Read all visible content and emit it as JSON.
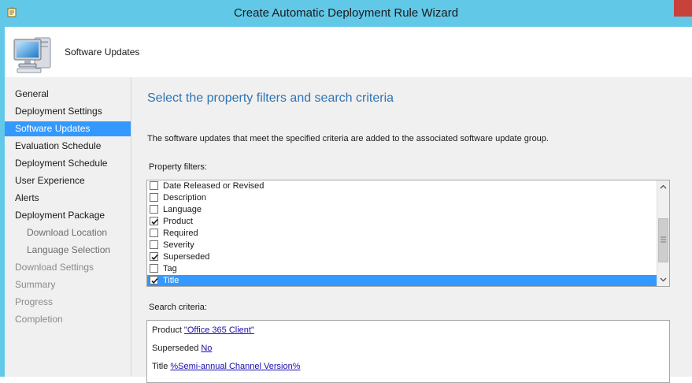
{
  "window": {
    "title": "Create Automatic Deployment Rule Wizard"
  },
  "header": {
    "title": "Software Updates"
  },
  "nav": {
    "items": [
      {
        "label": "General",
        "state": "normal"
      },
      {
        "label": "Deployment Settings",
        "state": "normal"
      },
      {
        "label": "Software Updates",
        "state": "active"
      },
      {
        "label": "Evaluation Schedule",
        "state": "normal"
      },
      {
        "label": "Deployment Schedule",
        "state": "normal"
      },
      {
        "label": "User Experience",
        "state": "normal"
      },
      {
        "label": "Alerts",
        "state": "normal"
      },
      {
        "label": "Deployment Package",
        "state": "normal"
      },
      {
        "label": "Download Location",
        "state": "sub"
      },
      {
        "label": "Language Selection",
        "state": "sub"
      },
      {
        "label": "Download Settings",
        "state": "dim"
      },
      {
        "label": "Summary",
        "state": "dim"
      },
      {
        "label": "Progress",
        "state": "dim"
      },
      {
        "label": "Completion",
        "state": "dim"
      }
    ]
  },
  "main": {
    "heading": "Select the property filters and search criteria",
    "description": "The software updates that meet the specified criteria are added to the associated software update group.",
    "property_filters_label": "Property filters:",
    "property_filters": [
      {
        "label": "Date Released or Revised",
        "checked": false,
        "selected": false
      },
      {
        "label": "Description",
        "checked": false,
        "selected": false
      },
      {
        "label": "Language",
        "checked": false,
        "selected": false
      },
      {
        "label": "Product",
        "checked": true,
        "selected": false
      },
      {
        "label": "Required",
        "checked": false,
        "selected": false
      },
      {
        "label": "Severity",
        "checked": false,
        "selected": false
      },
      {
        "label": "Superseded",
        "checked": true,
        "selected": false
      },
      {
        "label": "Tag",
        "checked": false,
        "selected": false
      },
      {
        "label": "Title",
        "checked": true,
        "selected": true
      }
    ],
    "search_criteria_label": "Search criteria:",
    "search_criteria": [
      {
        "property": "Product",
        "value": "\"Office 365 Client\""
      },
      {
        "property": "Superseded",
        "value": "No"
      },
      {
        "property": "Title",
        "value": "%Semi-annual Channel Version%"
      }
    ]
  },
  "colors": {
    "title_bar": "#62c8e8",
    "selection": "#3399ff",
    "heading": "#2e74b5",
    "link": "#1a0dab",
    "close_button": "#c7423a"
  }
}
